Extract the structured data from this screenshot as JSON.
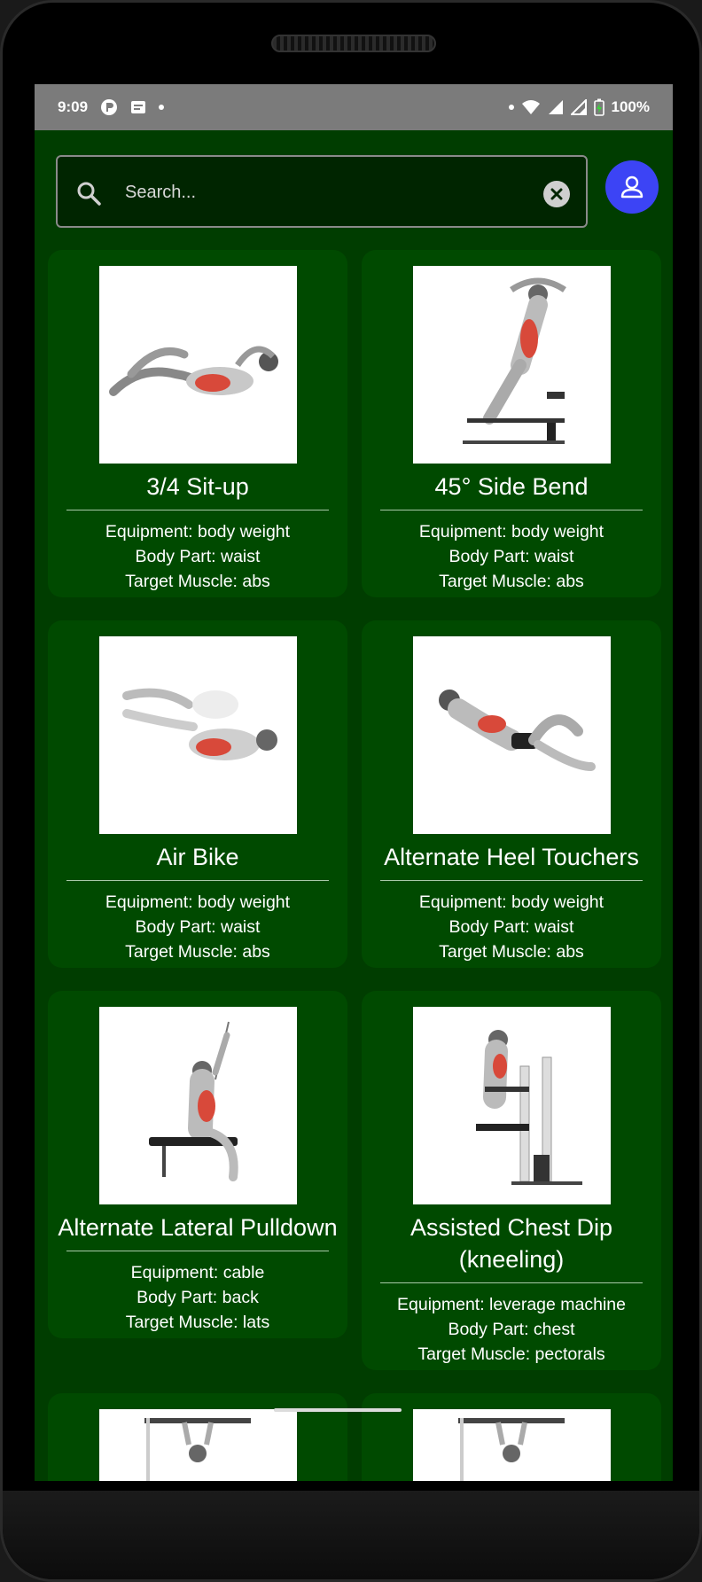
{
  "status_bar": {
    "time": "9:09",
    "battery": "100%",
    "left_icons": [
      "app-badge-icon",
      "notification-icon",
      "dot"
    ],
    "right_icons": [
      "dot",
      "wifi-icon",
      "signal-icon",
      "signal-icon",
      "battery-charging-icon"
    ]
  },
  "search": {
    "placeholder": "Search...",
    "value": ""
  },
  "colors": {
    "background": "#003d00",
    "card": "#004a00",
    "profile_button": "#3c44f5",
    "status_bar": "#7b7b7b"
  },
  "exercises": [
    {
      "name": "3/4 Sit-up",
      "equipment": "Equipment: body weight",
      "body_part": "Body Part: waist",
      "target": "Target Muscle: abs"
    },
    {
      "name": "45° Side Bend",
      "equipment": "Equipment: body weight",
      "body_part": "Body Part: waist",
      "target": "Target Muscle: abs"
    },
    {
      "name": "Air Bike",
      "equipment": "Equipment: body weight",
      "body_part": "Body Part: waist",
      "target": "Target Muscle: abs"
    },
    {
      "name": "Alternate Heel Touchers",
      "equipment": "Equipment: body weight",
      "body_part": "Body Part: waist",
      "target": "Target Muscle: abs"
    },
    {
      "name": "Alternate Lateral Pulldown",
      "equipment": "Equipment: cable",
      "body_part": "Body Part: back",
      "target": "Target Muscle: lats"
    },
    {
      "name": "Assisted Chest Dip (kneeling)",
      "equipment": "Equipment: leverage machine",
      "body_part": "Body Part: chest",
      "target": "Target Muscle: pectorals"
    }
  ]
}
